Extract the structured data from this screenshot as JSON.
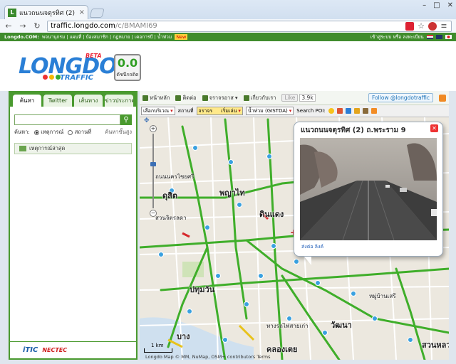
{
  "browser": {
    "tab_title": "แนวถนนจตุรทิศ (2) ถ.พระราม",
    "url_host": "traffic.longdo.com",
    "url_path": "/c/BMAMI69"
  },
  "topbar": {
    "links": [
      "Longdo.COM:",
      "พจนานุกรม",
      "แผนที่",
      "บ้องสมาชิก",
      "กฎหมาย",
      "เคอการบี",
      "น้ำท่วม",
      "New"
    ],
    "login": "เข้าสู่ระบบ หรือ ลงทะเบียน"
  },
  "logo": {
    "text": "LONGDO",
    "beta": "BETA",
    "sub": "TRAFFIC"
  },
  "index": {
    "value": "0.0",
    "label": "ดัชนีรถติด"
  },
  "left_panel": {
    "tabs": [
      "ค้นหา",
      "Twitter",
      "เส้นทาง",
      "ข่าวประกาศ"
    ],
    "search_placeholder": "",
    "search_by": "ค้นหา:",
    "radio_events": "เหตุการณ์",
    "radio_places": "สถานที่",
    "advanced": "ค้นหาขั้นสูง",
    "latest_section": "เหตุการณ์ล่าสุด",
    "footer_itic": "iTIC",
    "footer_nectec": "NECTEC"
  },
  "map_toolbar": {
    "home": "หน้าหลัก",
    "contact": "ติดต่อ",
    "traffic": "จราจรอาส",
    "about": "เกี่ยวกับเรา",
    "like": "Like",
    "like_count": "3.9k",
    "follow": "Follow @longdotraffic"
  },
  "map_bar": {
    "region": "เลือกบริเวณ",
    "station_label": "สถานที่",
    "station": "จราจร",
    "begin": "เริ่มเล่น",
    "flood": "น้ำท่วม (GISTDA)",
    "search_poi": "Search POI:"
  },
  "map_labels": [
    {
      "text": "พญาไท",
      "big": true
    },
    {
      "text": "ดินแดง",
      "big": true
    },
    {
      "text": "ปทุมวัน",
      "big": true
    },
    {
      "text": "วัฒนา",
      "big": true
    },
    {
      "text": "สวนหลว",
      "big": true
    },
    {
      "text": "ดุสิต",
      "big": true
    },
    {
      "text": "คลองเตย",
      "big": true
    },
    {
      "text": "สวนจิตรลดา",
      "big": false
    },
    {
      "text": "ถนนนครไชยศรี",
      "big": false
    },
    {
      "text": "หมู่บ้านเสรี",
      "big": false
    },
    {
      "text": "ทางรถไฟสายเก่า",
      "big": false
    },
    {
      "text": "บาง",
      "big": false
    }
  ],
  "scale_label": "1 km",
  "copyright": "Longdo Map © MM, NuMap, OSM+ contributors Terms",
  "popup": {
    "title": "แนวถนนจตุรทิศ (2) ถ.พระราม 9",
    "link": "ส่งต่อ ลิงค์"
  }
}
